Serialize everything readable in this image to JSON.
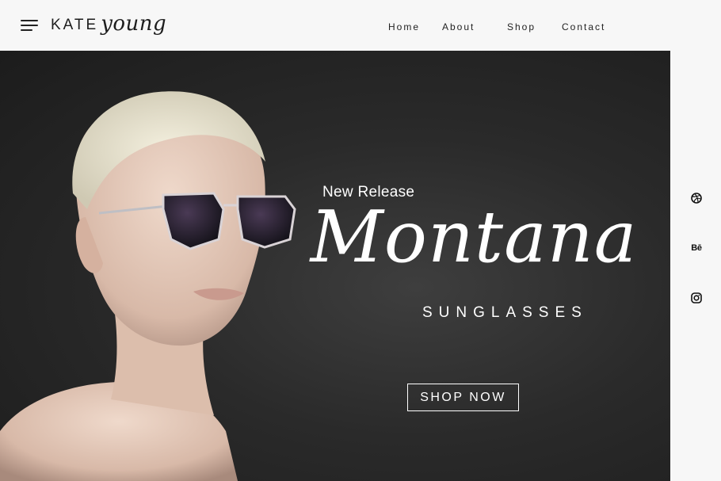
{
  "header": {
    "menu_icon": "hamburger-menu-icon",
    "logo_main": "KATE",
    "logo_script": "young",
    "nav": [
      {
        "label": "Home"
      },
      {
        "label": "About"
      },
      {
        "label": "Shop"
      },
      {
        "label": "Contact"
      }
    ]
  },
  "hero": {
    "tagline": "New Release",
    "product_name": "Montana",
    "product_sub": "SUNGLASSES",
    "cta_label": "SHOP NOW",
    "background_color": "#2a2a2a",
    "text_color": "#ffffff"
  },
  "social": [
    {
      "icon": "dribbble-icon"
    },
    {
      "icon": "behance-icon",
      "label": "Bē"
    },
    {
      "icon": "instagram-icon"
    }
  ]
}
